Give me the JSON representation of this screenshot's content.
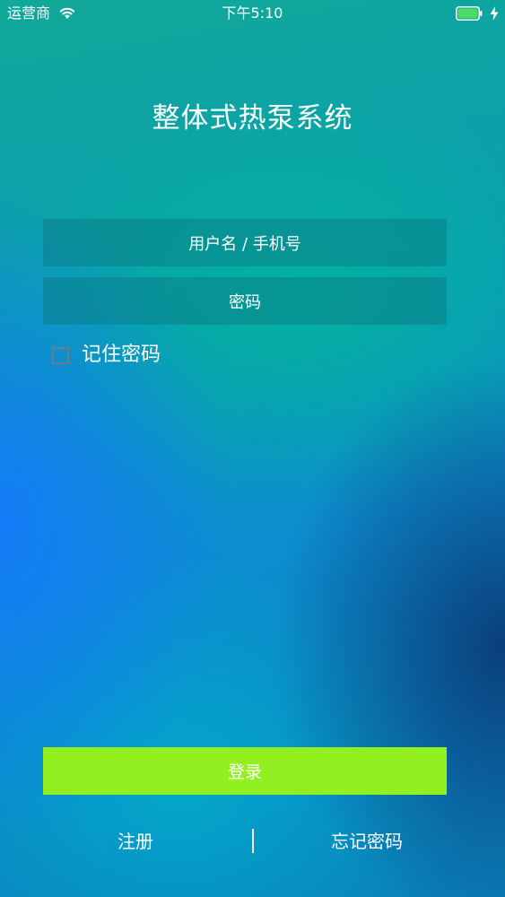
{
  "status_bar": {
    "carrier": "运营商",
    "time": "下午5:10",
    "battery_level": 1.0
  },
  "app": {
    "title": "整体式热泵系统"
  },
  "login_form": {
    "username_placeholder": "用户名 / 手机号",
    "password_placeholder": "密码",
    "remember_label": "记住密码",
    "remember_checked": false,
    "login_label": "登录"
  },
  "footer": {
    "register_label": "注册",
    "forgot_label": "忘记密码"
  },
  "colors": {
    "login_button": "#93f020",
    "battery": "#4cd964"
  }
}
